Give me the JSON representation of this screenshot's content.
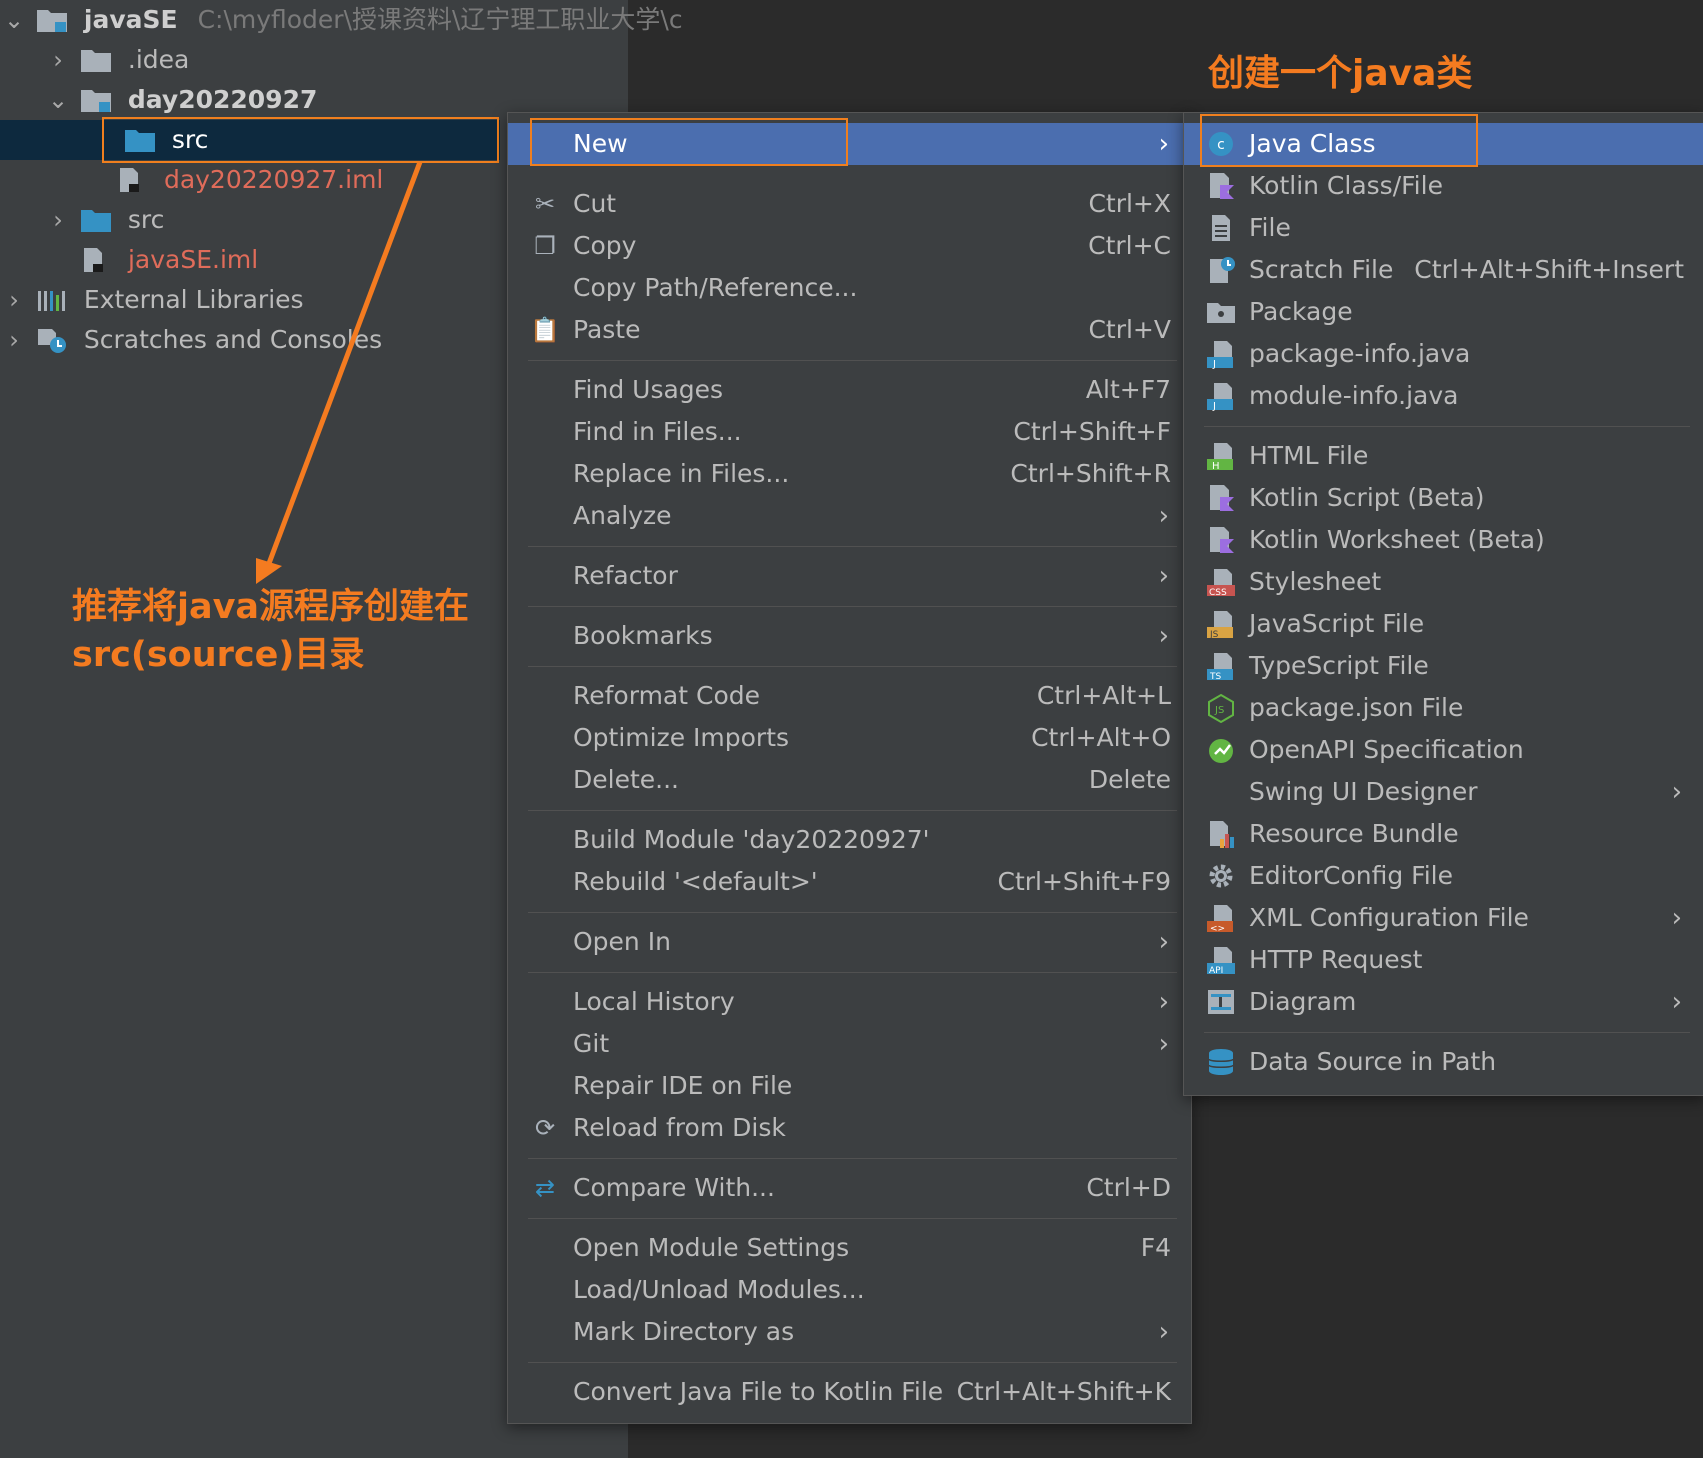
{
  "project_tree": {
    "root": {
      "name": "javaSE",
      "path": "C:\\myfloder\\授课资料\\辽宁理工职业大学\\c"
    },
    "items": [
      {
        "label": ".idea"
      },
      {
        "label": "day20220927"
      },
      {
        "label": "src"
      },
      {
        "label": "day20220927.iml"
      },
      {
        "label": "src"
      },
      {
        "label": "javaSE.iml"
      },
      {
        "label": "External Libraries"
      },
      {
        "label": "Scratches and Consoles"
      }
    ]
  },
  "context_menu": {
    "items": [
      {
        "label": "New",
        "shortcut": ""
      },
      {
        "label": "Cut",
        "shortcut": "Ctrl+X"
      },
      {
        "label": "Copy",
        "shortcut": "Ctrl+C"
      },
      {
        "label": "Copy Path/Reference...",
        "shortcut": ""
      },
      {
        "label": "Paste",
        "shortcut": "Ctrl+V"
      },
      {
        "label": "Find Usages",
        "shortcut": "Alt+F7"
      },
      {
        "label": "Find in Files...",
        "shortcut": "Ctrl+Shift+F"
      },
      {
        "label": "Replace in Files...",
        "shortcut": "Ctrl+Shift+R"
      },
      {
        "label": "Analyze",
        "shortcut": ""
      },
      {
        "label": "Refactor",
        "shortcut": ""
      },
      {
        "label": "Bookmarks",
        "shortcut": ""
      },
      {
        "label": "Reformat Code",
        "shortcut": "Ctrl+Alt+L"
      },
      {
        "label": "Optimize Imports",
        "shortcut": "Ctrl+Alt+O"
      },
      {
        "label": "Delete...",
        "shortcut": "Delete"
      },
      {
        "label": "Build Module 'day20220927'",
        "shortcut": ""
      },
      {
        "label": "Rebuild '<default>'",
        "shortcut": "Ctrl+Shift+F9"
      },
      {
        "label": "Open In",
        "shortcut": ""
      },
      {
        "label": "Local History",
        "shortcut": ""
      },
      {
        "label": "Git",
        "shortcut": ""
      },
      {
        "label": "Repair IDE on File",
        "shortcut": ""
      },
      {
        "label": "Reload from Disk",
        "shortcut": ""
      },
      {
        "label": "Compare With...",
        "shortcut": "Ctrl+D"
      },
      {
        "label": "Open Module Settings",
        "shortcut": "F4"
      },
      {
        "label": "Load/Unload Modules...",
        "shortcut": ""
      },
      {
        "label": "Mark Directory as",
        "shortcut": ""
      },
      {
        "label": "Convert Java File to Kotlin File",
        "shortcut": "Ctrl+Alt+Shift+K"
      }
    ]
  },
  "new_submenu": {
    "items": [
      {
        "label": "Java Class",
        "shortcut": ""
      },
      {
        "label": "Kotlin Class/File",
        "shortcut": ""
      },
      {
        "label": "File",
        "shortcut": ""
      },
      {
        "label": "Scratch File",
        "shortcut": "Ctrl+Alt+Shift+Insert"
      },
      {
        "label": "Package",
        "shortcut": ""
      },
      {
        "label": "package-info.java",
        "shortcut": ""
      },
      {
        "label": "module-info.java",
        "shortcut": ""
      },
      {
        "label": "HTML File",
        "shortcut": ""
      },
      {
        "label": "Kotlin Script (Beta)",
        "shortcut": ""
      },
      {
        "label": "Kotlin Worksheet (Beta)",
        "shortcut": ""
      },
      {
        "label": "Stylesheet",
        "shortcut": ""
      },
      {
        "label": "JavaScript File",
        "shortcut": ""
      },
      {
        "label": "TypeScript File",
        "shortcut": ""
      },
      {
        "label": "package.json File",
        "shortcut": ""
      },
      {
        "label": "OpenAPI Specification",
        "shortcut": ""
      },
      {
        "label": "Swing UI Designer",
        "shortcut": ""
      },
      {
        "label": "Resource Bundle",
        "shortcut": ""
      },
      {
        "label": "EditorConfig File",
        "shortcut": ""
      },
      {
        "label": "XML Configuration File",
        "shortcut": ""
      },
      {
        "label": "HTTP Request",
        "shortcut": ""
      },
      {
        "label": "Diagram",
        "shortcut": ""
      },
      {
        "label": "Data Source in Path",
        "shortcut": ""
      }
    ]
  },
  "annotations": {
    "top": "创建一个java类",
    "left_line1": "推荐将java源程序创建在",
    "left_line2": "src(source)目录"
  },
  "colors": {
    "accent_orange": "#f47b20",
    "highlight_blue": "#4b6eaf",
    "panel_bg": "#3c3f41",
    "editor_bg": "#2b2b2b"
  }
}
